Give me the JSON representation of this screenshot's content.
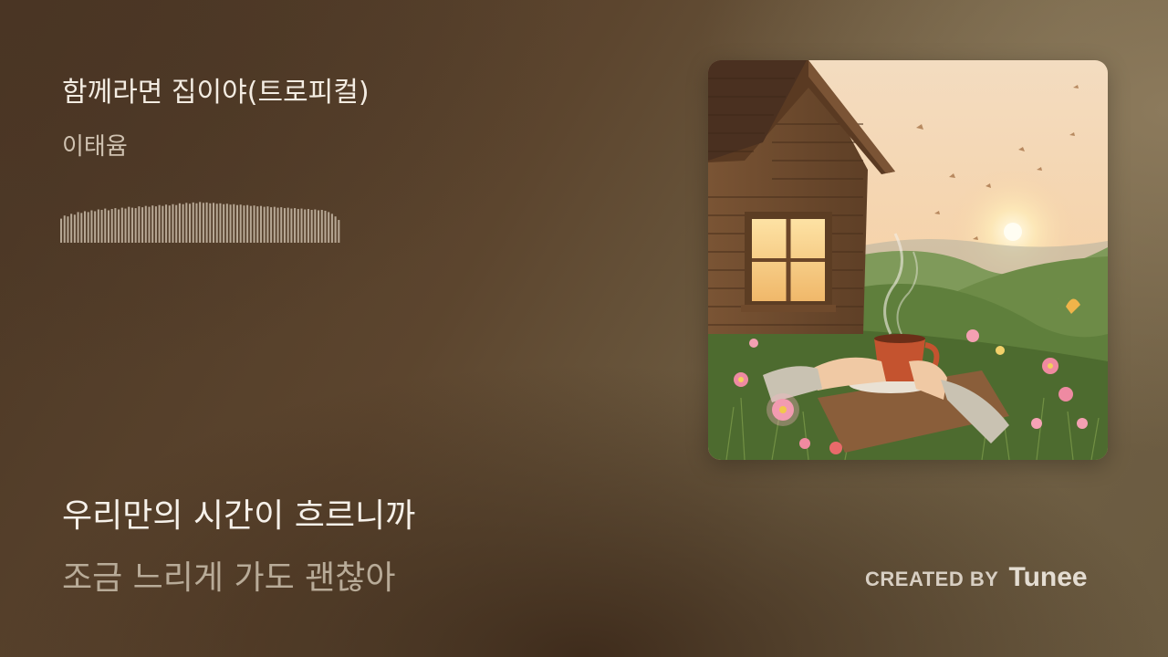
{
  "track": {
    "title": "함께라면 집이야(트로피컬)",
    "artist": "이태윰"
  },
  "lyrics": {
    "current": "우리만의 시간이 흐르니까",
    "next": "조금 느리게 가도 괜찮아"
  },
  "branding": {
    "created_by_label": "CREATED BY",
    "brand_name": "Tunee"
  },
  "colors": {
    "title_text": "#f3ece2",
    "artist_text": "#cfc2b1",
    "lyric_current": "#f6f1ea",
    "lyric_next": "#b8ab98",
    "waveform": "#c9bba8"
  },
  "waveform": {
    "levels": [
      0.55,
      0.62,
      0.6,
      0.66,
      0.64,
      0.7,
      0.68,
      0.72,
      0.7,
      0.74,
      0.72,
      0.76,
      0.75,
      0.78,
      0.74,
      0.77,
      0.79,
      0.76,
      0.8,
      0.78,
      0.82,
      0.8,
      0.79,
      0.83,
      0.81,
      0.84,
      0.82,
      0.85,
      0.83,
      0.86,
      0.84,
      0.87,
      0.85,
      0.88,
      0.86,
      0.9,
      0.88,
      0.91,
      0.89,
      0.92,
      0.9,
      0.93,
      0.91,
      0.92,
      0.9,
      0.91,
      0.89,
      0.9,
      0.88,
      0.89,
      0.87,
      0.88,
      0.86,
      0.87,
      0.85,
      0.86,
      0.84,
      0.85,
      0.83,
      0.84,
      0.82,
      0.83,
      0.81,
      0.82,
      0.8,
      0.81,
      0.79,
      0.8,
      0.78,
      0.79,
      0.77,
      0.78,
      0.76,
      0.77,
      0.75,
      0.76,
      0.74,
      0.75,
      0.73,
      0.7,
      0.66,
      0.6,
      0.52
    ]
  },
  "cover_art": {
    "icon": "cottage-sunset-artwork"
  }
}
